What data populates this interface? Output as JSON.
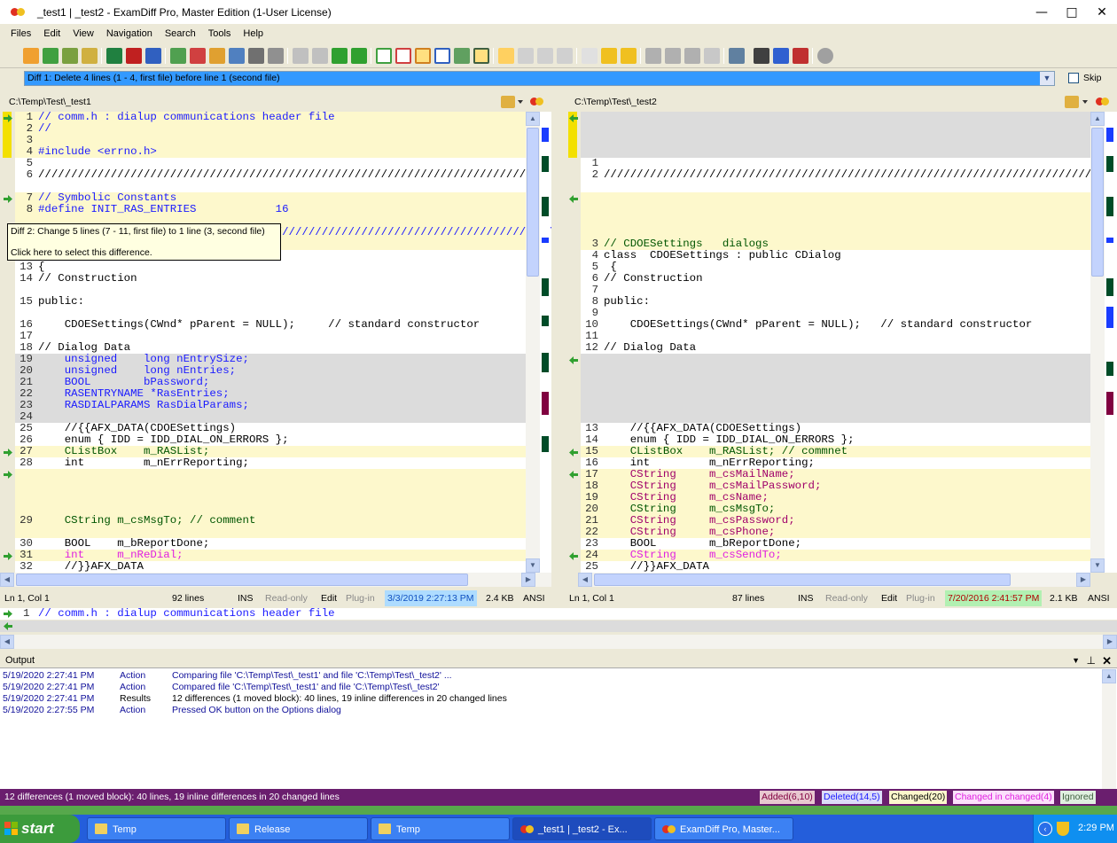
{
  "window": {
    "title": "_test1  |  _test2 - ExamDiff Pro, Master Edition (1-User License)",
    "controls": [
      "—",
      "□",
      "✕"
    ]
  },
  "menu": [
    "Files",
    "Edit",
    "View",
    "Navigation",
    "Search",
    "Tools",
    "Help"
  ],
  "diffbar": {
    "selected": "Diff 1: Delete 4 lines (1 - 4, first file) before line 1 (second file)",
    "skip_label": "Skip"
  },
  "left": {
    "path": "C:\\Temp\\Test\\_test1",
    "lines": [
      {
        "n": "1",
        "t": "// comm.h : dialup communications header file",
        "bg": "#fdf8cc",
        "c": "#1a1aff"
      },
      {
        "n": "2",
        "t": "//",
        "bg": "#fdf8cc",
        "c": "#1a1aff"
      },
      {
        "n": "3",
        "t": "",
        "bg": "#fdf8cc",
        "c": "#000"
      },
      {
        "n": "4",
        "t": "#include <errno.h>",
        "bg": "#fdf8cc",
        "c": "#1a1aff"
      },
      {
        "n": "5",
        "t": "",
        "bg": "#ffffff",
        "c": "#000"
      },
      {
        "n": "6",
        "t": "/////////////////////////////////////////////////////////////////////////////",
        "bg": "#ffffff",
        "c": "#000"
      },
      {
        "n": "",
        "t": "",
        "bg": "#ffffff",
        "c": "#000"
      },
      {
        "n": "7",
        "t": "// Symbolic Constants",
        "bg": "#fdf8cc",
        "c": "#1a1aff"
      },
      {
        "n": "8",
        "t": "#define INIT_RAS_ENTRIES            16",
        "bg": "#fdf8cc",
        "c": "#1a1aff"
      },
      {
        "n": "",
        "t": "",
        "bg": "#fdf8cc",
        "c": "#000"
      },
      {
        "n": "",
        "t": "                           ///////////////////////////////////////////////////",
        "bg": "#fdf8cc",
        "c": "#1a1aff"
      },
      {
        "n": "",
        "t": "",
        "bg": "#fdf8cc",
        "c": "#000"
      },
      {
        "n": "12",
        "t": "                                   og",
        "bg": "#ffffff",
        "c": "#000"
      },
      {
        "n": "13",
        "t": "{",
        "bg": "#ffffff",
        "c": "#000"
      },
      {
        "n": "14",
        "t": "// Construction",
        "bg": "#ffffff",
        "c": "#000"
      },
      {
        "n": "",
        "t": "",
        "bg": "#ffffff",
        "c": "#000"
      },
      {
        "n": "15",
        "t": "public:",
        "bg": "#ffffff",
        "c": "#000"
      },
      {
        "n": "",
        "t": "",
        "bg": "#ffffff",
        "c": "#000"
      },
      {
        "n": "16",
        "t": "    CDOESettings(CWnd* pParent = NULL);     // standard constructor",
        "bg": "#ffffff",
        "c": "#000"
      },
      {
        "n": "17",
        "t": "",
        "bg": "#ffffff",
        "c": "#000"
      },
      {
        "n": "18",
        "t": "// Dialog Data",
        "bg": "#ffffff",
        "c": "#000"
      },
      {
        "n": "19",
        "t": "    unsigned    long nEntrySize;",
        "bg": "#dcdcdc",
        "c": "#1a1aff"
      },
      {
        "n": "20",
        "t": "    unsigned    long nEntries;",
        "bg": "#dcdcdc",
        "c": "#1a1aff"
      },
      {
        "n": "21",
        "t": "    BOOL        bPassword;",
        "bg": "#dcdcdc",
        "c": "#1a1aff"
      },
      {
        "n": "22",
        "t": "    RASENTRYNAME *RasEntries;",
        "bg": "#dcdcdc",
        "c": "#1a1aff"
      },
      {
        "n": "23",
        "t": "    RASDIALPARAMS RasDialParams;",
        "bg": "#dcdcdc",
        "c": "#1a1aff"
      },
      {
        "n": "24",
        "t": "",
        "bg": "#dcdcdc",
        "c": "#000"
      },
      {
        "n": "25",
        "t": "    //{{AFX_DATA(CDOESettings)",
        "bg": "#ffffff",
        "c": "#000"
      },
      {
        "n": "26",
        "t": "    enum { IDD = IDD_DIAL_ON_ERRORS };",
        "bg": "#ffffff",
        "c": "#000"
      },
      {
        "n": "27",
        "t": "    CListBox    m_RASList;",
        "bg": "#fdf8cc",
        "c": "#005500"
      },
      {
        "n": "28",
        "t": "    int         m_nErrReporting;",
        "bg": "#ffffff",
        "c": "#000"
      },
      {
        "n": "",
        "t": "",
        "bg": "#fdf8cc",
        "c": "#000"
      },
      {
        "n": "",
        "t": "",
        "bg": "#fdf8cc",
        "c": "#000"
      },
      {
        "n": "",
        "t": "",
        "bg": "#fdf8cc",
        "c": "#000"
      },
      {
        "n": "",
        "t": "",
        "bg": "#fdf8cc",
        "c": "#000"
      },
      {
        "n": "29",
        "t": "    CString m_csMsgTo; // comment",
        "bg": "#fdf8cc",
        "c": "#005500"
      },
      {
        "n": "",
        "t": "",
        "bg": "#fdf8cc",
        "c": "#000"
      },
      {
        "n": "30",
        "t": "    BOOL    m_bReportDone;",
        "bg": "#ffffff",
        "c": "#000"
      },
      {
        "n": "31",
        "t": "    int     m_nReDial;",
        "bg": "#fdf8cc",
        "c": "#e020e0"
      },
      {
        "n": "32",
        "t": "    //}}AFX_DATA",
        "bg": "#ffffff",
        "c": "#000"
      }
    ],
    "status": {
      "pos": "Ln 1, Col 1",
      "count": "92 lines",
      "ins": "INS",
      "ro": "Read-only",
      "edit": "Edit",
      "plugin": "Plug-in",
      "date": "3/3/2019 2:27:13 PM",
      "size": "2.4 KB",
      "enc": "ANSI"
    }
  },
  "right": {
    "path": "C:\\Temp\\Test\\_test2",
    "lines": [
      {
        "n": "",
        "t": "",
        "bg": "#dcdcdc",
        "c": "#000"
      },
      {
        "n": "",
        "t": "",
        "bg": "#dcdcdc",
        "c": "#000"
      },
      {
        "n": "",
        "t": "",
        "bg": "#dcdcdc",
        "c": "#000"
      },
      {
        "n": "",
        "t": "",
        "bg": "#dcdcdc",
        "c": "#000"
      },
      {
        "n": "1",
        "t": "",
        "bg": "#ffffff",
        "c": "#000"
      },
      {
        "n": "2",
        "t": "////////////////////////////////////////////////////////////////////////////",
        "bg": "#ffffff",
        "c": "#000"
      },
      {
        "n": "",
        "t": "",
        "bg": "#ffffff",
        "c": "#000"
      },
      {
        "n": "",
        "t": "",
        "bg": "#fdf8cc",
        "c": "#000"
      },
      {
        "n": "",
        "t": "",
        "bg": "#fdf8cc",
        "c": "#000"
      },
      {
        "n": "",
        "t": "",
        "bg": "#fdf8cc",
        "c": "#000"
      },
      {
        "n": "",
        "t": "",
        "bg": "#fdf8cc",
        "c": "#000"
      },
      {
        "n": "3",
        "t": "// CDOESettings   dialogs",
        "bg": "#fdf8cc",
        "c": "#005500"
      },
      {
        "n": "4",
        "t": "class  CDOESettings : public CDialog",
        "bg": "#ffffff",
        "c": "#000"
      },
      {
        "n": "5",
        "t": " {",
        "bg": "#ffffff",
        "c": "#000"
      },
      {
        "n": "6",
        "t": "// Construction",
        "bg": "#ffffff",
        "c": "#000"
      },
      {
        "n": "7",
        "t": "",
        "bg": "#ffffff",
        "c": "#000"
      },
      {
        "n": "8",
        "t": "public:",
        "bg": "#ffffff",
        "c": "#000"
      },
      {
        "n": "9",
        "t": "",
        "bg": "#ffffff",
        "c": "#000"
      },
      {
        "n": "10",
        "t": "    CDOESettings(CWnd* pParent = NULL);   // standard constructor",
        "bg": "#ffffff",
        "c": "#000"
      },
      {
        "n": "11",
        "t": "",
        "bg": "#ffffff",
        "c": "#000"
      },
      {
        "n": "12",
        "t": "// Dialog Data",
        "bg": "#ffffff",
        "c": "#000"
      },
      {
        "n": "",
        "t": "",
        "bg": "#dcdcdc",
        "c": "#000"
      },
      {
        "n": "",
        "t": "",
        "bg": "#dcdcdc",
        "c": "#000"
      },
      {
        "n": "",
        "t": "",
        "bg": "#dcdcdc",
        "c": "#000"
      },
      {
        "n": "",
        "t": "",
        "bg": "#dcdcdc",
        "c": "#000"
      },
      {
        "n": "",
        "t": "",
        "bg": "#dcdcdc",
        "c": "#000"
      },
      {
        "n": "",
        "t": "",
        "bg": "#dcdcdc",
        "c": "#000"
      },
      {
        "n": "13",
        "t": "    //{{AFX_DATA(CDOESettings)",
        "bg": "#ffffff",
        "c": "#000"
      },
      {
        "n": "14",
        "t": "    enum { IDD = IDD_DIAL_ON_ERRORS };",
        "bg": "#ffffff",
        "c": "#000"
      },
      {
        "n": "15",
        "t": "    CListBox    m_RASList; // commnet",
        "bg": "#fdf8cc",
        "c": "#005500"
      },
      {
        "n": "16",
        "t": "    int         m_nErrReporting;",
        "bg": "#ffffff",
        "c": "#000"
      },
      {
        "n": "17",
        "t": "    CString     m_csMailName;",
        "bg": "#fdf8cc",
        "c": "#a0006a"
      },
      {
        "n": "18",
        "t": "    CString     m_csMailPassword;",
        "bg": "#fdf8cc",
        "c": "#a0006a"
      },
      {
        "n": "19",
        "t": "    CString     m_csName;",
        "bg": "#fdf8cc",
        "c": "#a0006a"
      },
      {
        "n": "20",
        "t": "    CString     m_csMsgTo;",
        "bg": "#fdf8cc",
        "c": "#005500"
      },
      {
        "n": "21",
        "t": "    CString     m_csPassword;",
        "bg": "#fdf8cc",
        "c": "#a0006a"
      },
      {
        "n": "22",
        "t": "    CString     m_csPhone;",
        "bg": "#fdf8cc",
        "c": "#a0006a"
      },
      {
        "n": "23",
        "t": "    BOOL        m_bReportDone;",
        "bg": "#ffffff",
        "c": "#000"
      },
      {
        "n": "24",
        "t": "    CString     m_csSendTo;",
        "bg": "#fdf8cc",
        "c": "#e020e0"
      },
      {
        "n": "25",
        "t": "    //}}AFX_DATA",
        "bg": "#ffffff",
        "c": "#000"
      }
    ],
    "status": {
      "pos": "Ln 1, Col 1",
      "count": "87 lines",
      "ins": "INS",
      "ro": "Read-only",
      "edit": "Edit",
      "plugin": "Plug-in",
      "date": "7/20/2016 2:41:57 PM",
      "size": "2.1 KB",
      "enc": "ANSI"
    }
  },
  "tooltip": {
    "line1": "Diff 2: Change 5 lines (7 - 11, first file) to 1 line (3, second file)",
    "line2": "Click here to select this difference."
  },
  "compare": {
    "num": "1",
    "text": "// comm.h : dialup communications header file"
  },
  "output": {
    "title": "Output",
    "rows": [
      {
        "time": "5/19/2020 2:27:41 PM",
        "type": "Action",
        "msg": "Comparing file 'C:\\Temp\\Test\\_test1' and file 'C:\\Temp\\Test\\_test2' ..."
      },
      {
        "time": "5/19/2020 2:27:41 PM",
        "type": "Action",
        "msg": "Compared file 'C:\\Temp\\Test\\_test1' and file 'C:\\Temp\\Test\\_test2'"
      },
      {
        "time": "5/19/2020 2:27:41 PM",
        "type": "Results",
        "msg": "12 differences (1 moved block): 40 lines, 19 inline differences in 20 changed lines"
      },
      {
        "time": "5/19/2020 2:27:55 PM",
        "type": "Action",
        "msg": "Pressed OK button on the Options dialog"
      }
    ]
  },
  "statusbar": {
    "summary": "12 differences (1 moved block): 40 lines, 19 inline differences in 20 changed lines",
    "added": "Added(6,10)",
    "deleted": "Deleted(14,5)",
    "changed": "Changed(20)",
    "cic": "Changed in changed(4)",
    "ignored": "Ignored"
  },
  "taskbar": {
    "start": "start",
    "tasks": [
      "Temp",
      "Release",
      "Temp",
      "_test1  |  _test2 - Ex...",
      "ExamDiff Pro, Master..."
    ],
    "clock": "2:29 PM"
  },
  "colors": {
    "added": "#fdf8cc",
    "deleted": "#dcdcdc",
    "changed": "#fdf8cc",
    "accent": "#3399ff",
    "status_bg": "#6a1e6e"
  }
}
